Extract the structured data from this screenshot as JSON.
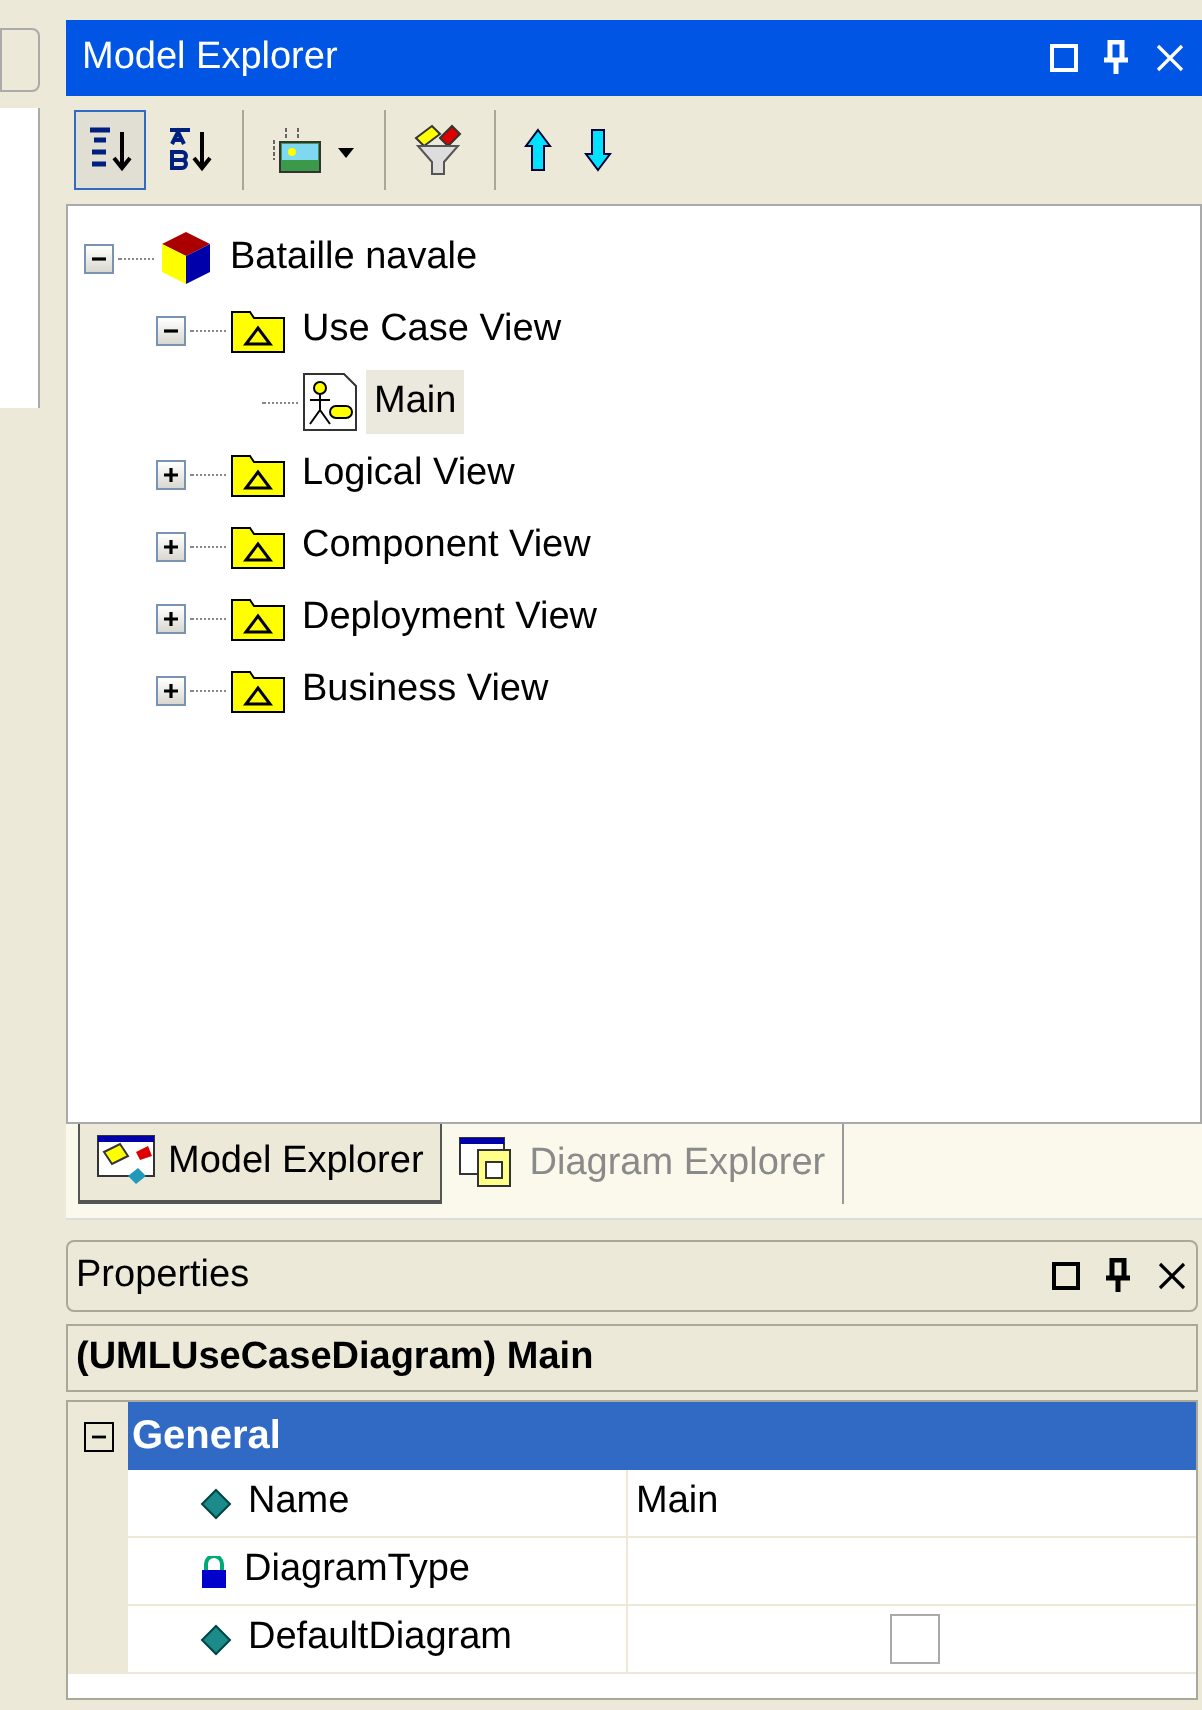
{
  "explorer": {
    "title": "Model Explorer",
    "toolbar": [
      {
        "kind": "sort-order",
        "selected": true
      },
      {
        "kind": "sort-alpha",
        "selected": false
      },
      {
        "kind": "view",
        "selected": false
      },
      {
        "kind": "filter",
        "selected": false
      },
      {
        "kind": "up",
        "selected": false
      },
      {
        "kind": "down",
        "selected": false
      }
    ],
    "tree": [
      {
        "label": "Bataille navale",
        "kind": "model",
        "expanded": true,
        "selected": false,
        "children": [
          {
            "label": "Use Case View",
            "kind": "folder",
            "expanded": true,
            "selected": false,
            "children": [
              {
                "label": "Main",
                "kind": "diagram",
                "selected": true
              }
            ]
          },
          {
            "label": "Logical View",
            "kind": "folder",
            "expanded": false,
            "selected": false
          },
          {
            "label": "Component View",
            "kind": "folder",
            "expanded": false,
            "selected": false
          },
          {
            "label": "Deployment View",
            "kind": "folder",
            "expanded": false,
            "selected": false
          },
          {
            "label": "Business View",
            "kind": "folder",
            "expanded": false,
            "selected": false
          }
        ]
      }
    ],
    "tabs": [
      {
        "label": "Model Explorer",
        "selected": true
      },
      {
        "label": "Diagram Explorer",
        "selected": false
      }
    ]
  },
  "properties": {
    "title": "Properties",
    "subject": "(UMLUseCaseDiagram) Main",
    "groups": [
      {
        "label": "General",
        "expanded": true,
        "rows": [
          {
            "name": "Name",
            "kind": "text",
            "locked": false,
            "value": "Main"
          },
          {
            "name": "DiagramType",
            "kind": "text",
            "locked": true
          },
          {
            "name": "DefaultDiagram",
            "kind": "checkbox",
            "locked": false,
            "checked": false
          }
        ]
      }
    ]
  }
}
